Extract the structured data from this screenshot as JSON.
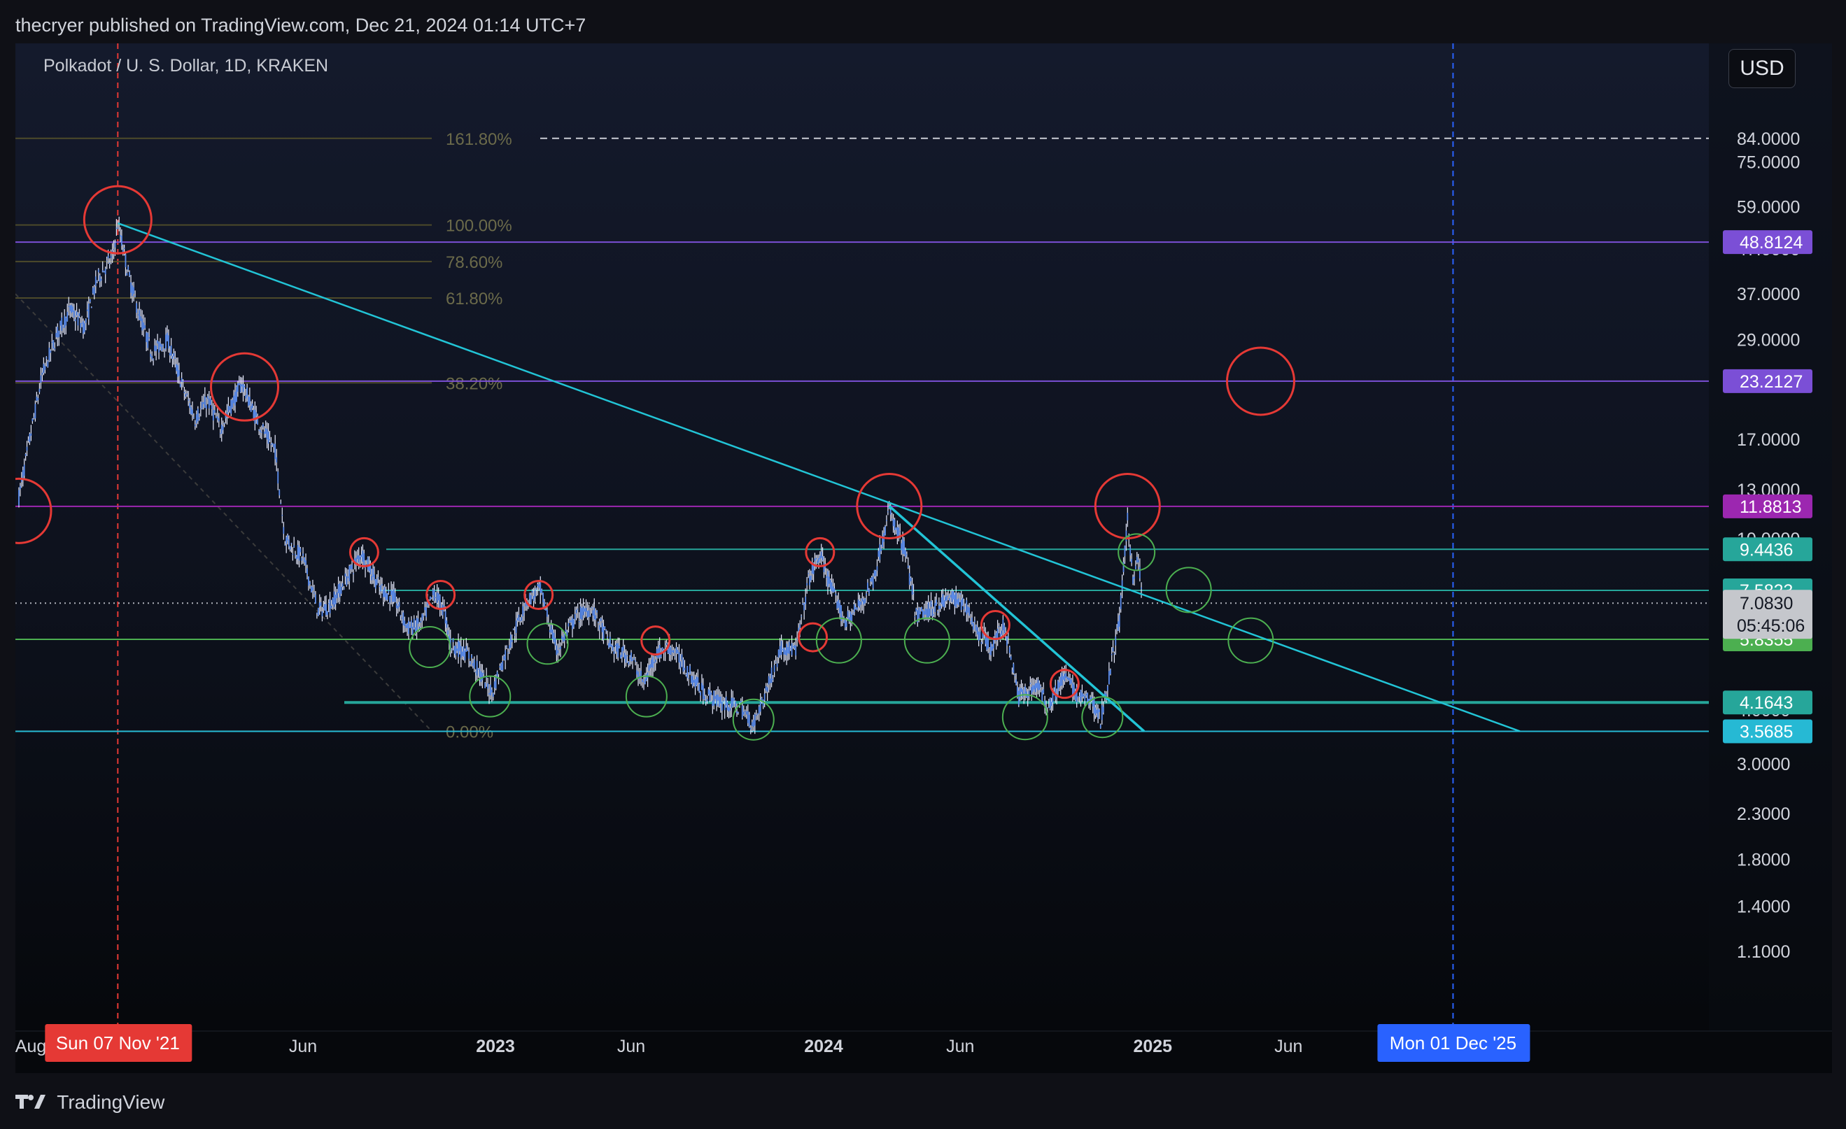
{
  "header": {
    "published_text": "thecryer published on TradingView.com, Dec 21, 2024 01:14 UTC+7"
  },
  "symbol": {
    "title": "Polkadot / U. S. Dollar, 1D, KRAKEN"
  },
  "currency_button": "USD",
  "footer": {
    "brand": "TradingView"
  },
  "colors": {
    "background": "#0f1016",
    "candle": "#5b8dee",
    "candle_wick": "#e8ecff",
    "trendline": "#22c4d6",
    "fib_line": "#4d4a2a",
    "fib_text": "#6b6a4a",
    "resistance_purple": "#7b4fd6",
    "support_green": "#3fae5a",
    "support_teal": "#26a69a",
    "circle_red": "#e53935",
    "circle_green": "#4caf50",
    "crosshair_red": "#e53935",
    "crosshair_blue": "#2962ff"
  },
  "chart_data": {
    "type": "candlestick",
    "symbol": "Polkadot / U. S. Dollar",
    "interval": "1D",
    "exchange": "KRAKEN",
    "y_scale": "log",
    "ylim": [
      1.0,
      90.0
    ],
    "x_ticks": [
      "Aug",
      "Jun",
      "2023",
      "Jun",
      "2024",
      "Jun",
      "2025",
      "Jun"
    ],
    "y_ticks": [
      75.0,
      59.0,
      47.0,
      37.0,
      29.0,
      17.0,
      13.0,
      10.0,
      4.0,
      3.0,
      2.3,
      1.8,
      1.4,
      1.1
    ],
    "y_tick_labels": [
      "75.0000",
      "59.0000",
      "47.0000",
      "37.0000",
      "29.0000",
      "17.0000",
      "13.0000",
      "10.0000",
      "4.0000",
      "3.0000",
      "2.3000",
      "1.8000",
      "1.4000",
      "1.1000"
    ],
    "price_levels": [
      {
        "label": "48.8124",
        "value": 48.8124,
        "color": "#7b4fd6"
      },
      {
        "label": "23.2127",
        "value": 23.2127,
        "color": "#7b4fd6"
      },
      {
        "label": "11.8813",
        "value": 11.8813,
        "color": "#9c27b0"
      },
      {
        "label": "9.4436",
        "value": 9.4436,
        "color": "#26a69a"
      },
      {
        "label": "7.5823",
        "value": 7.5823,
        "color": "#26a69a"
      },
      {
        "label": "5.8355",
        "value": 5.8355,
        "color": "#4caf50"
      },
      {
        "label": "4.1643",
        "value": 4.1643,
        "color": "#26a69a"
      },
      {
        "label": "3.5685",
        "value": 3.5685,
        "color": "#26b9d4"
      }
    ],
    "last_price": {
      "label": "7.0830",
      "value": 7.083,
      "countdown": "05:45:06"
    },
    "fib_levels": [
      {
        "label": "161.80%",
        "value": 85.0
      },
      {
        "label": "100.00%",
        "value": 53.5
      },
      {
        "label": "78.60%",
        "value": 44.0
      },
      {
        "label": "61.80%",
        "value": 36.2
      },
      {
        "label": "38.20%",
        "value": 23.0
      },
      {
        "label": "0.00%",
        "value": 3.57
      }
    ],
    "crosshair_labels": {
      "left": "Sun 07 Nov '21",
      "right": "Mon 01 Dec '25"
    },
    "price_path": [
      [
        "2021-07-20",
        12.5
      ],
      [
        "2021-08-01",
        17.0
      ],
      [
        "2021-08-15",
        24.0
      ],
      [
        "2021-09-01",
        30.0
      ],
      [
        "2021-09-15",
        34.0
      ],
      [
        "2021-10-01",
        31.0
      ],
      [
        "2021-10-15",
        40.0
      ],
      [
        "2021-11-01",
        45.0
      ],
      [
        "2021-11-07",
        54.0
      ],
      [
        "2021-11-20",
        40.0
      ],
      [
        "2021-12-01",
        33.0
      ],
      [
        "2021-12-15",
        27.0
      ],
      [
        "2022-01-01",
        29.0
      ],
      [
        "2022-01-20",
        22.0
      ],
      [
        "2022-02-01",
        19.0
      ],
      [
        "2022-02-15",
        21.0
      ],
      [
        "2022-03-01",
        18.0
      ],
      [
        "2022-03-25",
        23.0
      ],
      [
        "2022-04-10",
        19.0
      ],
      [
        "2022-05-01",
        16.0
      ],
      [
        "2022-05-12",
        10.0
      ],
      [
        "2022-06-01",
        9.0
      ],
      [
        "2022-06-18",
        6.8
      ],
      [
        "2022-07-01",
        7.0
      ],
      [
        "2022-07-15",
        7.8
      ],
      [
        "2022-08-05",
        9.3
      ],
      [
        "2022-08-25",
        7.7
      ],
      [
        "2022-09-10",
        7.3
      ],
      [
        "2022-09-25",
        6.2
      ],
      [
        "2022-10-10",
        6.3
      ],
      [
        "2022-10-25",
        7.5
      ],
      [
        "2022-11-05",
        6.8
      ],
      [
        "2022-11-12",
        5.7
      ],
      [
        "2022-12-01",
        5.4
      ],
      [
        "2022-12-28",
        4.4
      ],
      [
        "2023-01-15",
        5.6
      ],
      [
        "2023-02-05",
        7.2
      ],
      [
        "2023-02-20",
        7.6
      ],
      [
        "2023-03-10",
        5.5
      ],
      [
        "2023-04-01",
        6.6
      ],
      [
        "2023-04-18",
        6.9
      ],
      [
        "2023-05-10",
        5.6
      ],
      [
        "2023-06-01",
        5.3
      ],
      [
        "2023-06-15",
        4.6
      ],
      [
        "2023-06-28",
        5.4
      ],
      [
        "2023-07-15",
        5.6
      ],
      [
        "2023-08-01",
        5.0
      ],
      [
        "2023-08-20",
        4.4
      ],
      [
        "2023-09-10",
        4.15
      ],
      [
        "2023-10-01",
        4.05
      ],
      [
        "2023-10-15",
        3.7
      ],
      [
        "2023-11-01",
        4.6
      ],
      [
        "2023-11-15",
        5.6
      ],
      [
        "2023-12-01",
        5.5
      ],
      [
        "2023-12-15",
        8.0
      ],
      [
        "2023-12-28",
        9.2
      ],
      [
        "2024-01-10",
        7.6
      ],
      [
        "2024-01-25",
        6.4
      ],
      [
        "2024-02-10",
        7.0
      ],
      [
        "2024-02-25",
        8.0
      ],
      [
        "2024-03-14",
        11.6
      ],
      [
        "2024-04-01",
        9.3
      ],
      [
        "2024-04-13",
        6.6
      ],
      [
        "2024-05-01",
        6.9
      ],
      [
        "2024-05-20",
        7.3
      ],
      [
        "2024-06-05",
        7.1
      ],
      [
        "2024-06-20",
        6.1
      ],
      [
        "2024-07-05",
        5.6
      ],
      [
        "2024-07-20",
        6.3
      ],
      [
        "2024-08-05",
        4.3
      ],
      [
        "2024-08-25",
        4.6
      ],
      [
        "2024-09-06",
        4.1
      ],
      [
        "2024-09-25",
        4.8
      ],
      [
        "2024-10-10",
        4.3
      ],
      [
        "2024-10-25",
        4.2
      ],
      [
        "2024-11-04",
        3.8
      ],
      [
        "2024-11-15",
        5.0
      ],
      [
        "2024-11-25",
        6.5
      ],
      [
        "2024-12-04",
        11.0
      ],
      [
        "2024-12-10",
        8.2
      ],
      [
        "2024-12-16",
        9.0
      ],
      [
        "2024-12-21",
        7.08
      ]
    ]
  }
}
